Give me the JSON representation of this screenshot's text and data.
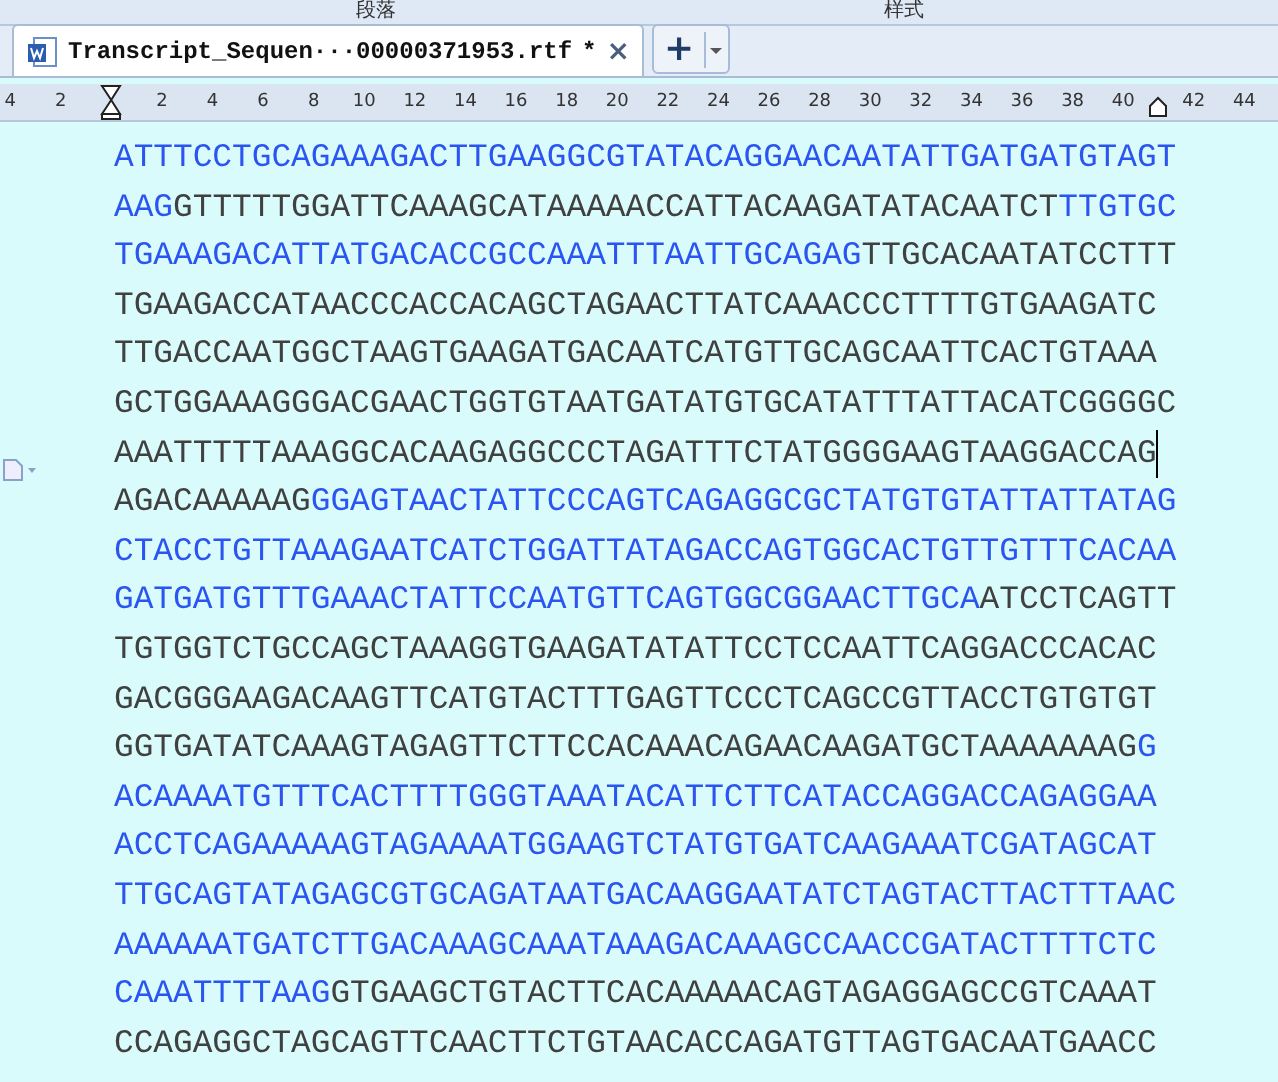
{
  "ribbon": {
    "groups": [
      {
        "label": "段落"
      },
      {
        "label": "样式"
      }
    ]
  },
  "tabs": [
    {
      "title": "Transcript_Sequen···00000371953.rtf",
      "modified_mark": "*",
      "close": "×",
      "selected": true
    }
  ],
  "new_tab": {
    "label": "+"
  },
  "ruler": [
    {
      "kind": "number",
      "label": "4"
    },
    {
      "kind": "number",
      "label": "2"
    },
    {
      "kind": "indent"
    },
    {
      "kind": "number",
      "label": "2"
    },
    {
      "kind": "number",
      "label": "4"
    },
    {
      "kind": "number",
      "label": "6"
    },
    {
      "kind": "number",
      "label": "8"
    },
    {
      "kind": "number",
      "label": "10"
    },
    {
      "kind": "number",
      "label": "12"
    },
    {
      "kind": "number",
      "label": "14"
    },
    {
      "kind": "number",
      "label": "16"
    },
    {
      "kind": "number",
      "label": "18"
    },
    {
      "kind": "number",
      "label": "20"
    },
    {
      "kind": "number",
      "label": "22"
    },
    {
      "kind": "number",
      "label": "24"
    },
    {
      "kind": "number",
      "label": "26"
    },
    {
      "kind": "number",
      "label": "28"
    },
    {
      "kind": "number",
      "label": "30"
    },
    {
      "kind": "number",
      "label": "32"
    },
    {
      "kind": "number",
      "label": "34"
    },
    {
      "kind": "number",
      "label": "36"
    },
    {
      "kind": "number",
      "label": "38"
    },
    {
      "kind": "number",
      "label": "40"
    },
    {
      "kind": "right"
    },
    {
      "kind": "number",
      "label": "42"
    },
    {
      "kind": "number",
      "label": "44"
    }
  ],
  "lines": [
    {
      "cursor": false,
      "segments": [
        {
          "text": "ATTTCCTGCAGAAAGACTTGAAGGCGTATACAGGAACAATATTGATGATGTAGT",
          "color": "#2b55f0"
        }
      ]
    },
    {
      "cursor": false,
      "segments": [
        {
          "text": "AAG",
          "color": "#2b55f0"
        },
        {
          "text": "GTTTTTGGATTCAAAGCATAAAAACCATTACAAGATATACAATCT",
          "color": "#404040"
        },
        {
          "text": "TTGTGC",
          "color": "#2b55f0"
        }
      ]
    },
    {
      "cursor": false,
      "segments": [
        {
          "text": "TGAAAGACATTATGACACCGCCAAATTTAATTGCAGAG",
          "color": "#2b55f0"
        },
        {
          "text": "TTGCACAATATCCTTT",
          "color": "#404040"
        }
      ]
    },
    {
      "cursor": false,
      "segments": [
        {
          "text": "TGAAGACCATAACCCACCACAGCTAGAACTTATCAAACCCTTTTGTGAAGATC",
          "color": "#404040"
        }
      ]
    },
    {
      "cursor": false,
      "segments": [
        {
          "text": "TTGACCAATGGCTAAGTGAAGATGACAATCATGTTGCAGCAATTCACTGTAAA",
          "color": "#404040"
        }
      ]
    },
    {
      "cursor": false,
      "segments": [
        {
          "text": "GCTGGAAAGGGACGAACTGGTGTAATGATATGTGCATATTTATTACATCGGGGC",
          "color": "#404040"
        }
      ]
    },
    {
      "cursor": true,
      "segments": [
        {
          "text": "AAATTTTTAAAGGCACAAGAGGCCCTAGATTTCTATGGGGAAGTAAGGACCAG",
          "color": "#404040"
        }
      ]
    },
    {
      "cursor": false,
      "segments": [
        {
          "text": "AGACAAAAAG",
          "color": "#404040"
        },
        {
          "text": "GGAGTAACTATTCCCAGTCAGAGGCGCTATGTGTATTATTATAG",
          "color": "#2b55f0"
        }
      ]
    },
    {
      "cursor": false,
      "segments": [
        {
          "text": "CTACCTGTTAAAGAATCATCTGGATTATAGACCAGTGGCACTGTTGTTTCACAA",
          "color": "#2b55f0"
        }
      ]
    },
    {
      "cursor": false,
      "segments": [
        {
          "text": "GATGATGTTTGAAACTATTCCAATGTTCAGTGGCGGAACTTGCA",
          "color": "#2b55f0"
        },
        {
          "text": "ATCCTCAGTT",
          "color": "#404040"
        }
      ]
    },
    {
      "cursor": false,
      "segments": [
        {
          "text": "TGTGGTCTGCCAGCTAAAGGTGAAGATATATTCCTCCAATTCAGGACCCACAC",
          "color": "#404040"
        }
      ]
    },
    {
      "cursor": false,
      "segments": [
        {
          "text": "GACGGGAAGACAAGTTCATGTACTTTGAGTTCCCTCAGCCGTTACCTGTGTGT",
          "color": "#404040"
        }
      ]
    },
    {
      "cursor": false,
      "segments": [
        {
          "text": "GGTGATATCAAAGTAGAGTTCTTCCACAAACAGAACAAGATGCTAAAAAAAG",
          "color": "#404040"
        },
        {
          "text": "G",
          "color": "#2b55f0"
        }
      ]
    },
    {
      "cursor": false,
      "segments": [
        {
          "text": "ACAAAATGTTTCACTTTTGGGTAAATACATTCTTCATACCAGGACCAGAGGAA",
          "color": "#2b55f0"
        }
      ]
    },
    {
      "cursor": false,
      "segments": [
        {
          "text": "ACCTCAGAAAAAGTAGAAAATGGAAGTCTATGTGATCAAGAAATCGATAGCAT",
          "color": "#2b55f0"
        }
      ]
    },
    {
      "cursor": false,
      "segments": [
        {
          "text": "TTGCAGTATAGAGCGTGCAGATAATGACAAGGAATATCTAGTACTTACTTTAAC",
          "color": "#2b55f0"
        }
      ]
    },
    {
      "cursor": false,
      "segments": [
        {
          "text": "AAAAAATGATCTTGACAAAGCAAATAAAGACAAAGCCAACCGATACTTTTCTC",
          "color": "#2b55f0"
        }
      ]
    },
    {
      "cursor": false,
      "segments": [
        {
          "text": "CAAATTTTAAG",
          "color": "#2b55f0"
        },
        {
          "text": "GTGAAGCTGTACTTCACAAAAACAGTAGAGGAGCCGTCAAAT",
          "color": "#404040"
        }
      ]
    },
    {
      "cursor": false,
      "segments": [
        {
          "text": "CCAGAGGCTAGCAGTTCAACTTCTGTAACACCAGATGTTAGTGACAATGAACC",
          "color": "#404040"
        }
      ]
    }
  ]
}
